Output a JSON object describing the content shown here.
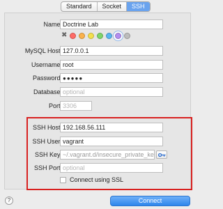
{
  "tabs": [
    {
      "label": "Standard"
    },
    {
      "label": "Socket"
    },
    {
      "label": "SSH"
    }
  ],
  "colors": {
    "clear_glyph": "✖",
    "swatches": [
      "#ff6b66",
      "#fbb24c",
      "#f4e04d",
      "#7ed56a",
      "#5ab6f0",
      "#b28ef0",
      "#bdbdbd"
    ],
    "selected_index": 5,
    "ssh_highlight": "#d8201f",
    "connect_button": "#2e86ec"
  },
  "form": {
    "name": {
      "label": "Name:",
      "value": "Doctrine Lab"
    },
    "host": {
      "label": "MySQL Host:",
      "value": "127.0.0.1"
    },
    "username": {
      "label": "Username:",
      "value": "root"
    },
    "password": {
      "label": "Password:",
      "value": "●●●●●"
    },
    "database": {
      "label": "Database:",
      "placeholder": "optional"
    },
    "port": {
      "label": "Port:",
      "placeholder": "3306"
    }
  },
  "ssh": {
    "host": {
      "label": "SSH Host:",
      "value": "192.168.56.111"
    },
    "user": {
      "label": "SSH User:",
      "value": "vagrant"
    },
    "key": {
      "label": "SSH Key:",
      "value": "~/.vagrant.d/insecure_private_key"
    },
    "port": {
      "label": "SSH Port:",
      "placeholder": "optional"
    },
    "ssl_label": "Connect using SSL"
  },
  "footer": {
    "help": "?",
    "connect": "Connect"
  }
}
